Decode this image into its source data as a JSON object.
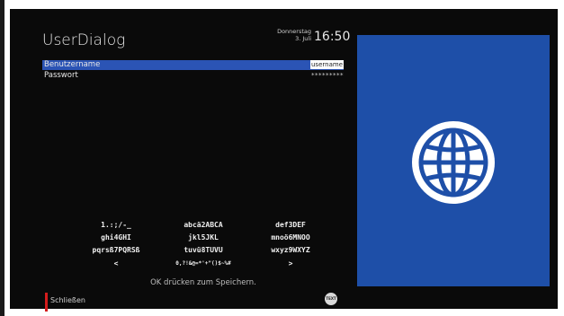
{
  "header": {
    "title": "UserDialog",
    "date_weekday": "Donnerstag",
    "date_day": "3. Juli",
    "time": "16:50"
  },
  "fields": [
    {
      "label": "Benutzername",
      "value": "username",
      "selected": true
    },
    {
      "label": "Passwort",
      "value": "*********",
      "selected": false
    }
  ],
  "keyboard": {
    "rows": [
      [
        "1.:;/-_",
        "abcä2ABCA",
        "def3DEF"
      ],
      [
        "ghi4GHI",
        "jkl5JKL",
        "mnoö6MNOO"
      ],
      [
        "pqrsß7PQRSß",
        "tuvü8TUVU",
        "wxyz9WXYZ"
      ],
      [
        "<",
        "0,?!&@=*'+\"()$~%#",
        ">"
      ]
    ]
  },
  "hint": "OK drücken zum Speichern.",
  "footer": {
    "close_label": "Schließen",
    "text_icon_label": "TEXT"
  },
  "colors": {
    "selection": "#2b54b5",
    "panel": "#1e4fa8",
    "red_key": "#d41c1c"
  },
  "icons": {
    "panel": "globe-icon",
    "text_button": "text-key-icon"
  }
}
